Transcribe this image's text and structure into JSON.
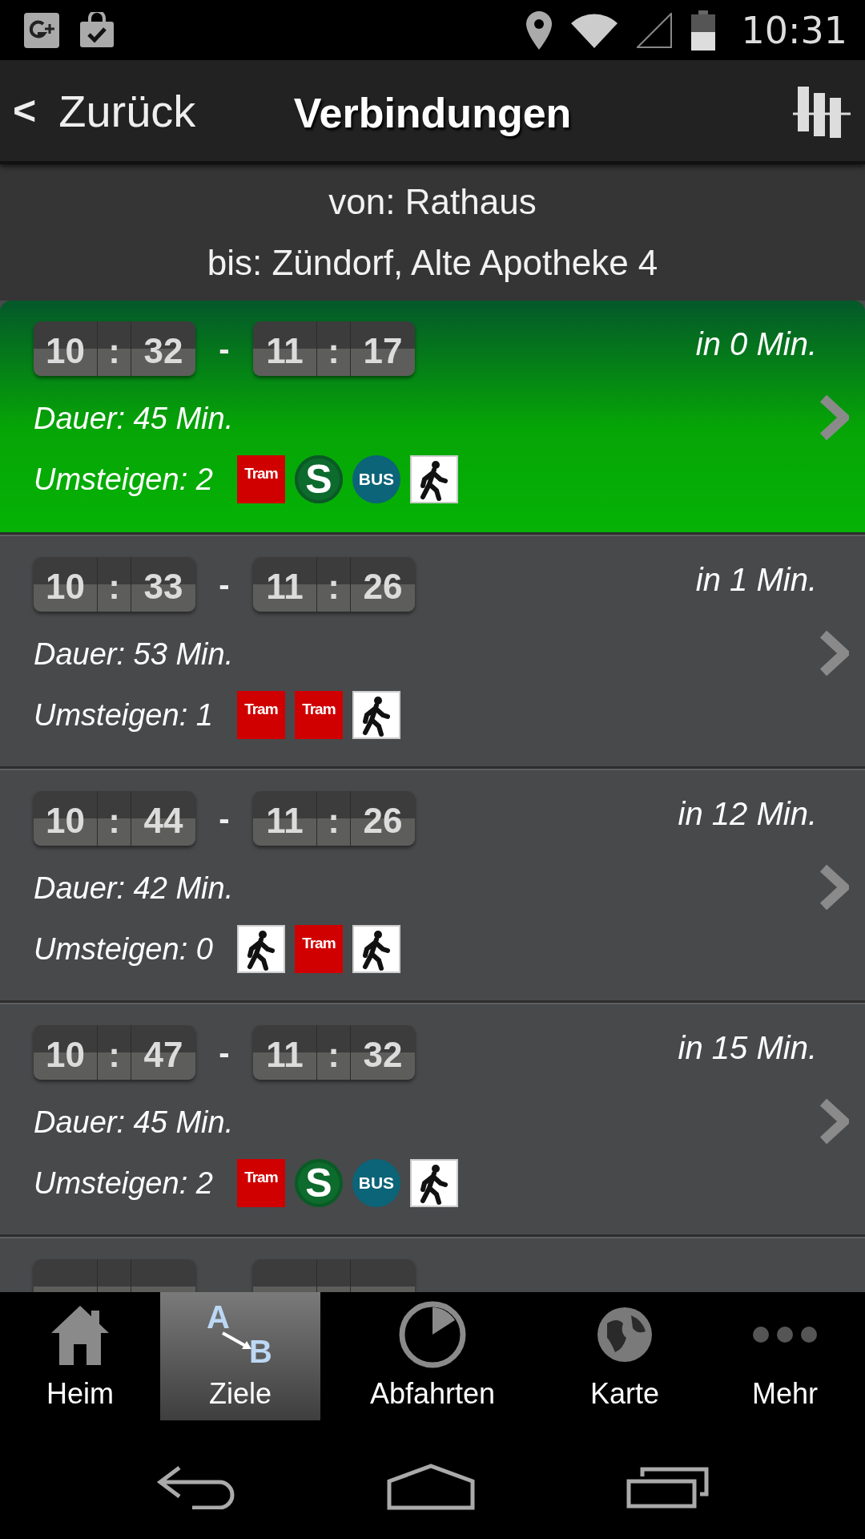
{
  "status_bar": {
    "time": "10:31"
  },
  "header": {
    "back_symbol": "<",
    "back_label": "Zurück",
    "title": "Verbindungen"
  },
  "route": {
    "from": "von: Rathaus",
    "to": "bis: Zündorf, Alte Apotheke 4"
  },
  "connections": [
    {
      "selected": true,
      "departure": [
        "10",
        "32"
      ],
      "arrival": [
        "11",
        "17"
      ],
      "separator": ":",
      "dash": "-",
      "countdown": "in 0 Min.",
      "duration": "Dauer: 45 Min.",
      "transfers": "Umsteigen: 2",
      "modes": [
        {
          "kind": "tram",
          "label": "Tram"
        },
        {
          "kind": "sbahn",
          "label": "S"
        },
        {
          "kind": "bus",
          "label": "BUS"
        },
        {
          "kind": "walk"
        }
      ]
    },
    {
      "selected": false,
      "departure": [
        "10",
        "33"
      ],
      "arrival": [
        "11",
        "26"
      ],
      "separator": ":",
      "dash": "-",
      "countdown": "in 1 Min.",
      "duration": "Dauer: 53 Min.",
      "transfers": "Umsteigen: 1",
      "modes": [
        {
          "kind": "tram",
          "label": "Tram"
        },
        {
          "kind": "tram",
          "label": "Tram"
        },
        {
          "kind": "walk"
        }
      ]
    },
    {
      "selected": false,
      "departure": [
        "10",
        "44"
      ],
      "arrival": [
        "11",
        "26"
      ],
      "separator": ":",
      "dash": "-",
      "countdown": "in 12 Min.",
      "duration": "Dauer: 42 Min.",
      "transfers": "Umsteigen: 0",
      "modes": [
        {
          "kind": "walk"
        },
        {
          "kind": "tram",
          "label": "Tram"
        },
        {
          "kind": "walk"
        }
      ]
    },
    {
      "selected": false,
      "departure": [
        "10",
        "47"
      ],
      "arrival": [
        "11",
        "32"
      ],
      "separator": ":",
      "dash": "-",
      "countdown": "in 15 Min.",
      "duration": "Dauer: 45 Min.",
      "transfers": "Umsteigen: 2",
      "modes": [
        {
          "kind": "tram",
          "label": "Tram"
        },
        {
          "kind": "sbahn",
          "label": "S"
        },
        {
          "kind": "bus",
          "label": "BUS"
        },
        {
          "kind": "walk"
        }
      ]
    },
    {
      "selected": false
    }
  ],
  "tab_bar": [
    {
      "kind": "home",
      "label": "Heim",
      "selected": false
    },
    {
      "kind": "route",
      "label": "Ziele",
      "selected": true,
      "icon_letters": [
        "A",
        "B"
      ]
    },
    {
      "kind": "departures",
      "label": "Abfahrten",
      "selected": false
    },
    {
      "kind": "map",
      "label": "Karte",
      "selected": false
    },
    {
      "kind": "more",
      "label": "Mehr",
      "selected": false
    }
  ]
}
